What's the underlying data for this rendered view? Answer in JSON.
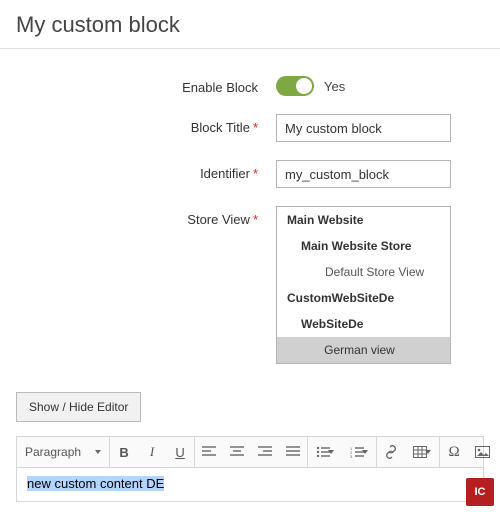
{
  "page": {
    "title": "My custom block"
  },
  "form": {
    "enable": {
      "label": "Enable Block",
      "value_text": "Yes"
    },
    "title": {
      "label": "Block Title",
      "value": "My custom block"
    },
    "identifier": {
      "label": "Identifier",
      "value": "my_custom_block"
    },
    "store_view": {
      "label": "Store View",
      "options": [
        {
          "label": "Main Website",
          "level": 0
        },
        {
          "label": "Main Website Store",
          "level": 1
        },
        {
          "label": "Default Store View",
          "level": 2
        },
        {
          "label": "CustomWebSiteDe",
          "level": 0
        },
        {
          "label": "WebSiteDe",
          "level": 1
        },
        {
          "label": "German view",
          "level": 2,
          "selected": true
        }
      ]
    }
  },
  "editor": {
    "toggle_button": "Show / Hide Editor",
    "format_select": "Paragraph",
    "content_selected": "new custom content DE"
  },
  "badge": "IC"
}
